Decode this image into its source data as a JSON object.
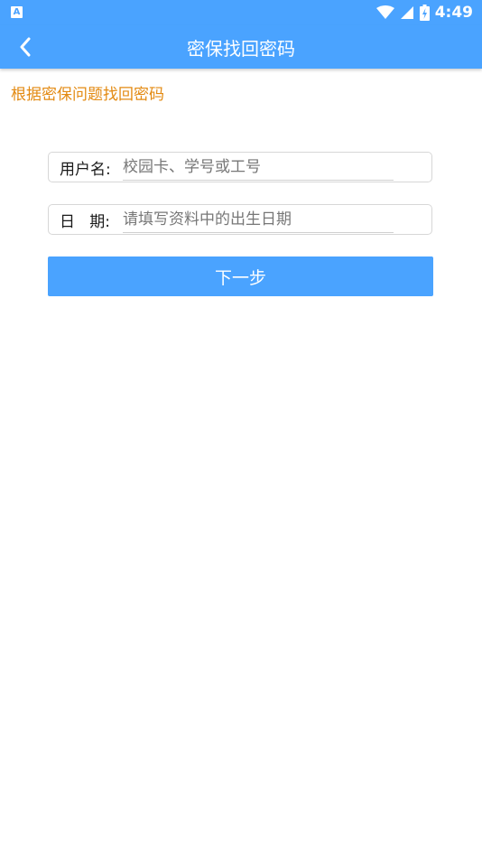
{
  "status_bar": {
    "app_icon_letter": "A",
    "time": "4:49",
    "icons": [
      "wifi-icon",
      "cellular-signal-icon",
      "battery-icon"
    ]
  },
  "header": {
    "title": "密保找回密码",
    "back_icon": "chevron-left-icon"
  },
  "subtitle": "根据密保问题找回密码",
  "form": {
    "username": {
      "label": "用户名:",
      "value": "",
      "placeholder": "校园卡、学号或工号"
    },
    "date": {
      "label": "日   期:",
      "value": "",
      "placeholder": "请填写资料中的出生日期"
    },
    "next_label": "下一步"
  },
  "colors": {
    "primary": "#4aa3ff",
    "subtitle_text": "#e38a12",
    "background": "#ffffff"
  }
}
